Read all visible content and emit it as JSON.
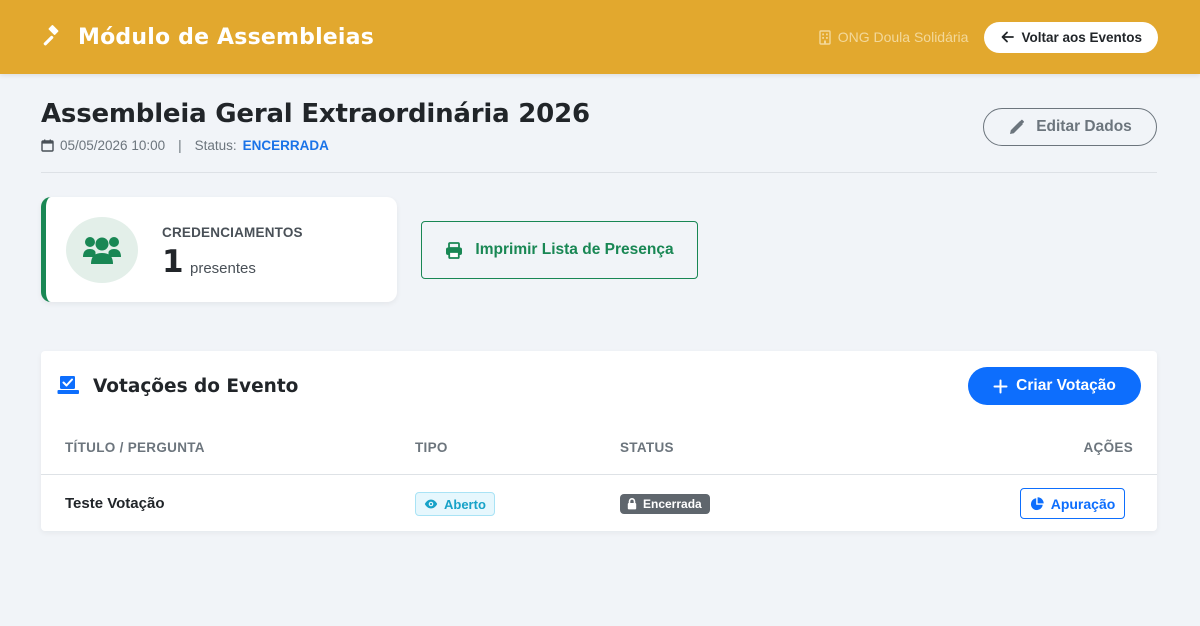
{
  "topbar": {
    "app_title": "Módulo de Assembleias",
    "organization": "ONG Doula Solidária",
    "back_label": "Voltar aos Eventos"
  },
  "event": {
    "title": "Assembleia Geral Extraordinária 2026",
    "datetime": "05/05/2026 10:00",
    "separator": "|",
    "status_label": "Status:",
    "status_value": "ENCERRADA",
    "edit_label": "Editar Dados"
  },
  "credentials": {
    "label": "CREDENCIAMENTOS",
    "count": "1",
    "unit": "presentes"
  },
  "print_label": "Imprimir Lista de Presença",
  "votes": {
    "title": "Votações do Evento",
    "create_label": "Criar Votação",
    "columns": [
      "TÍTULO / PERGUNTA",
      "TIPO",
      "STATUS",
      "AÇÕES"
    ],
    "rows": [
      {
        "title": "Teste Votação",
        "type": "Aberto",
        "status": "Encerrada",
        "action": "Apuração"
      }
    ]
  },
  "colors": {
    "topbar": "#e2a82e",
    "success": "#198754",
    "primary": "#0d6efd",
    "status_link": "#1a73e8",
    "info": "#17a2c8",
    "secondary": "#5f666d"
  },
  "icons": {
    "brand": "gavel-icon",
    "organization": "building-icon",
    "back": "arrow-left-icon",
    "date": "calendar-icon",
    "edit": "pencil-icon",
    "credentials": "users-icon",
    "print": "printer-icon",
    "votes": "vote-check-icon",
    "create": "plus-icon",
    "type_open": "eye-icon",
    "status_closed": "lock-icon",
    "result": "pie-chart-icon"
  }
}
